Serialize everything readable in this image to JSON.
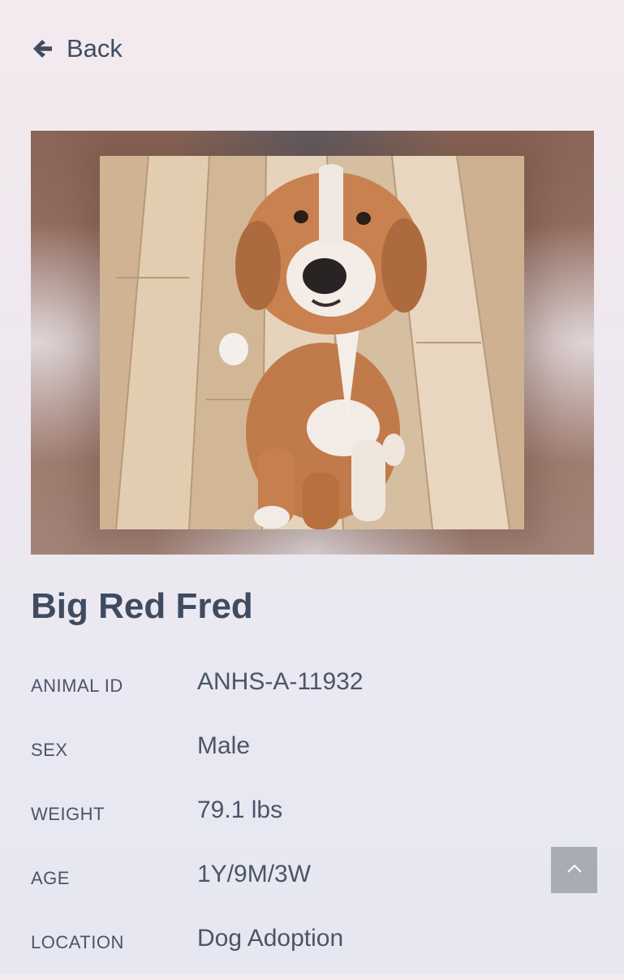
{
  "nav": {
    "back_label": "Back",
    "back_icon": "arrow-left-icon"
  },
  "photo": {
    "subject": "dog-photo"
  },
  "pet": {
    "name": "Big Red Fred"
  },
  "details": [
    {
      "label": "ANIMAL ID",
      "value": "ANHS-A-11932"
    },
    {
      "label": "SEX",
      "value": "Male"
    },
    {
      "label": "WEIGHT",
      "value": "79.1 lbs"
    },
    {
      "label": "AGE",
      "value": "1Y/9M/3W"
    },
    {
      "label": "LOCATION",
      "value": "Dog Adoption"
    }
  ],
  "scroll_top": {
    "icon": "chevron-up-icon"
  },
  "colors": {
    "text": "#4a5568",
    "heading": "#3f4b60",
    "scroll_button_bg": "#a9acb3"
  }
}
